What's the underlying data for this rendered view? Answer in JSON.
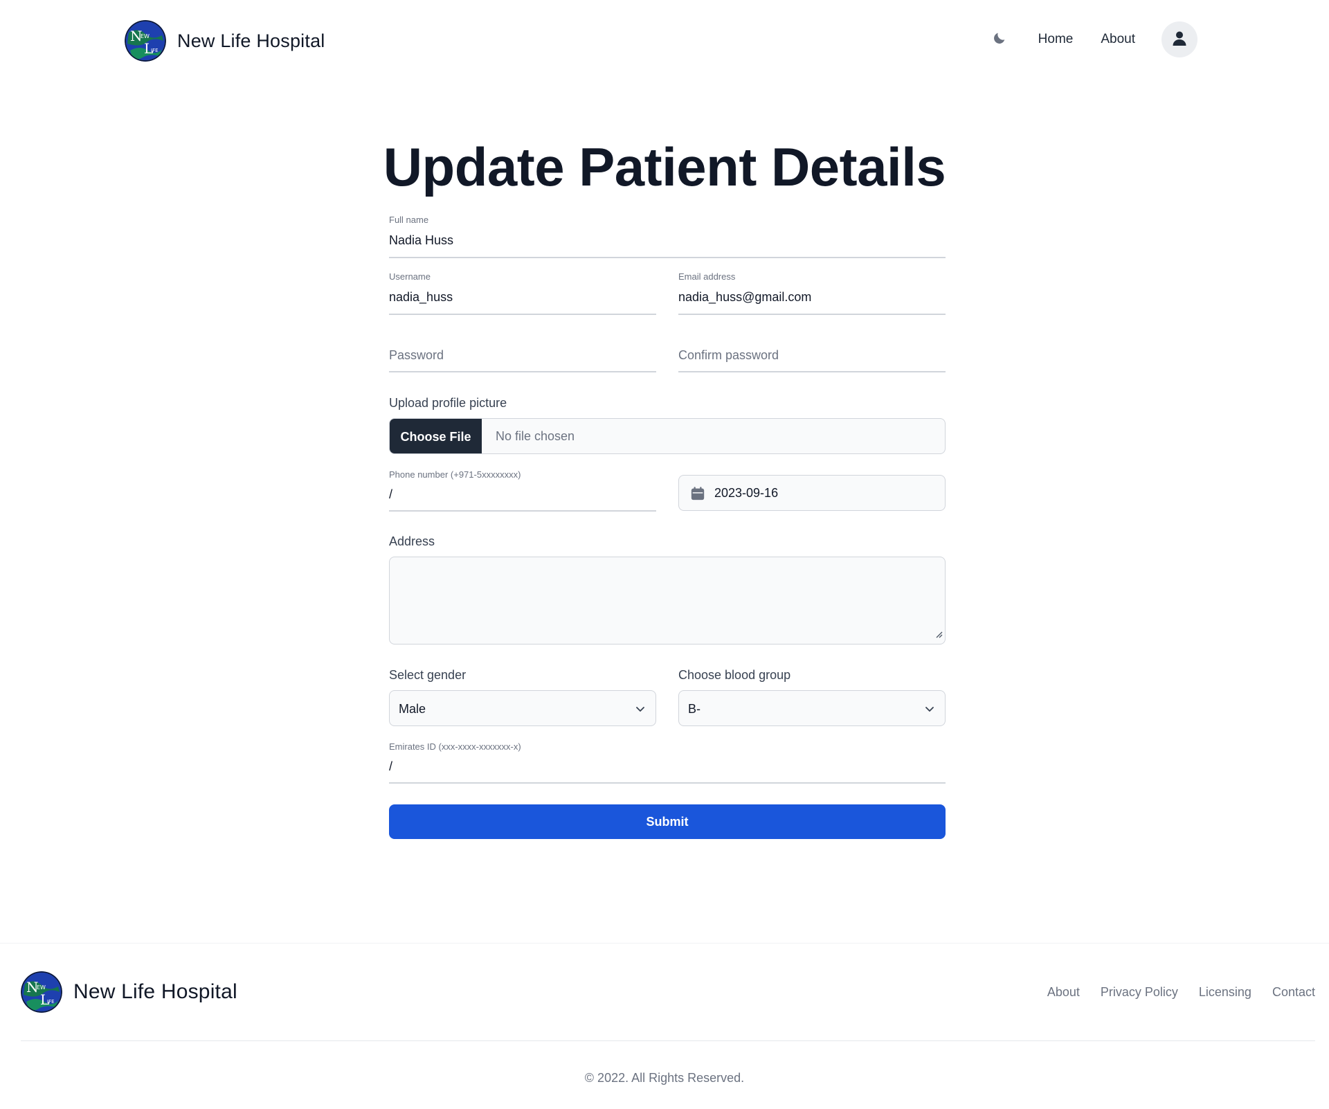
{
  "header": {
    "brand_name": "New Life Hospital",
    "logo_letters": {
      "n": "N",
      "ew": "EW",
      "l": "L",
      "ife": "IFE"
    },
    "nav_links": [
      "Home",
      "About"
    ]
  },
  "form": {
    "title": "Update Patient Details",
    "full_name": {
      "label": "Full name",
      "value": "Nadia Huss"
    },
    "username": {
      "label": "Username",
      "value": "nadia_huss"
    },
    "email": {
      "label": "Email address",
      "value": "nadia_huss@gmail.com"
    },
    "password": {
      "placeholder": "Password"
    },
    "confirm_password": {
      "placeholder": "Confirm password"
    },
    "upload": {
      "label": "Upload profile picture",
      "button": "Choose File",
      "status": "No file chosen"
    },
    "phone": {
      "label": "Phone number (+971-5xxxxxxxx)",
      "value": "/"
    },
    "date": {
      "value": "2023-09-16"
    },
    "address": {
      "label": "Address",
      "value": ""
    },
    "gender": {
      "label": "Select gender",
      "value": "Male"
    },
    "blood_group": {
      "label": "Choose blood group",
      "value": "B-"
    },
    "emirates_id": {
      "label": "Emirates ID (xxx-xxxx-xxxxxxx-x)",
      "value": "/"
    },
    "submit_label": "Submit"
  },
  "footer": {
    "brand_name": "New Life Hospital",
    "links": [
      "About",
      "Privacy Policy",
      "Licensing",
      "Contact"
    ],
    "copyright": "© 2022. All Rights Reserved."
  },
  "colors": {
    "primary_button": "#1a56db",
    "dark_button": "#1f2937",
    "text_primary": "#111827",
    "text_muted": "#6b7280"
  },
  "icons": [
    "moon-icon",
    "user-icon",
    "calendar-icon",
    "chevron-down-icon",
    "resize-handle-icon"
  ]
}
